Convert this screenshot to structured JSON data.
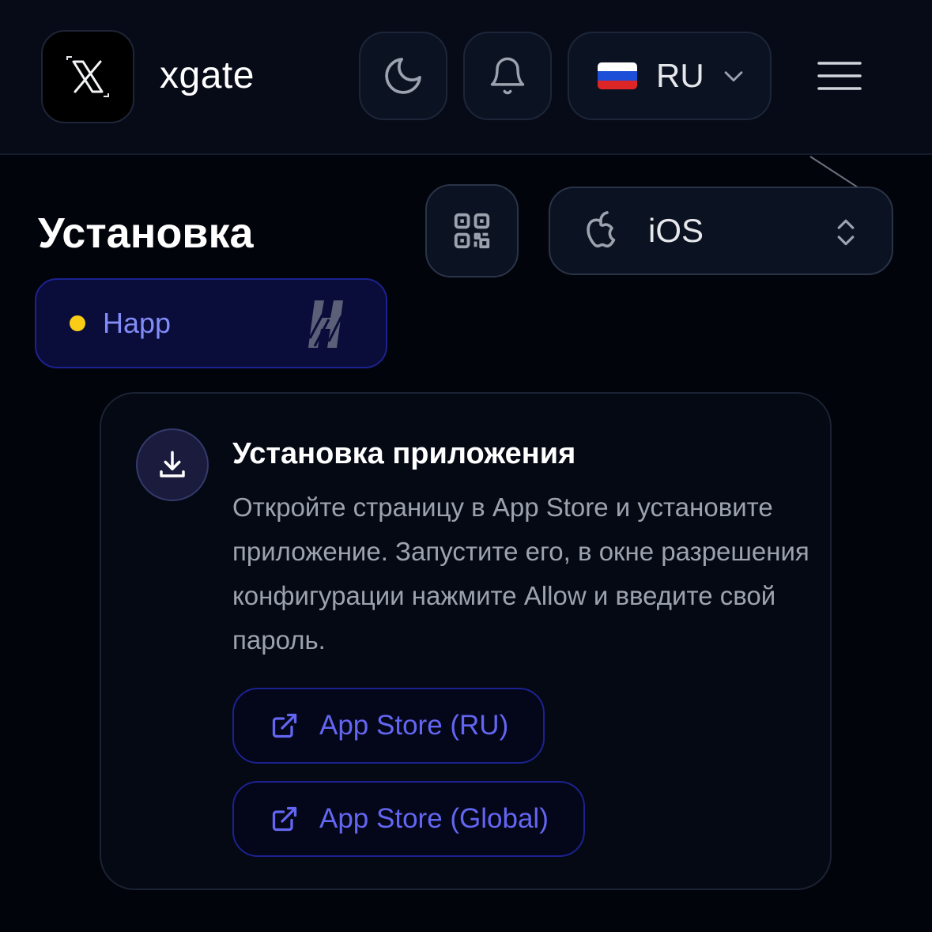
{
  "header": {
    "brand": "xgate",
    "language_code": "RU"
  },
  "install": {
    "title": "Установка",
    "os_selected": "iOS"
  },
  "app_chip": {
    "name": "Happ",
    "status_color": "#facc15"
  },
  "card": {
    "title": "Установка приложения",
    "description": "Откройте страницу в App Store и установите приложение. Запустите его, в окне разрешения конфигурации нажмите Allow и введите свой пароль.",
    "buttons": [
      {
        "label": "App Store (RU)"
      },
      {
        "label": "App Store (Global)"
      }
    ]
  },
  "colors": {
    "accent": "#6366f1",
    "background": "#02040b",
    "chip_background": "#0a0c3a"
  },
  "icons": {
    "logo": "x-logo-icon",
    "theme": "moon-icon",
    "notifications": "bell-icon",
    "flag": "russia-flag-icon",
    "language_chevron": "chevron-down-icon",
    "menu": "hamburger-menu-icon",
    "qr": "qr-code-icon",
    "os": "apple-icon",
    "os_chevron": "chevron-up-down-icon",
    "app": "happ-logo-icon",
    "step": "download-icon",
    "external": "external-link-icon"
  }
}
